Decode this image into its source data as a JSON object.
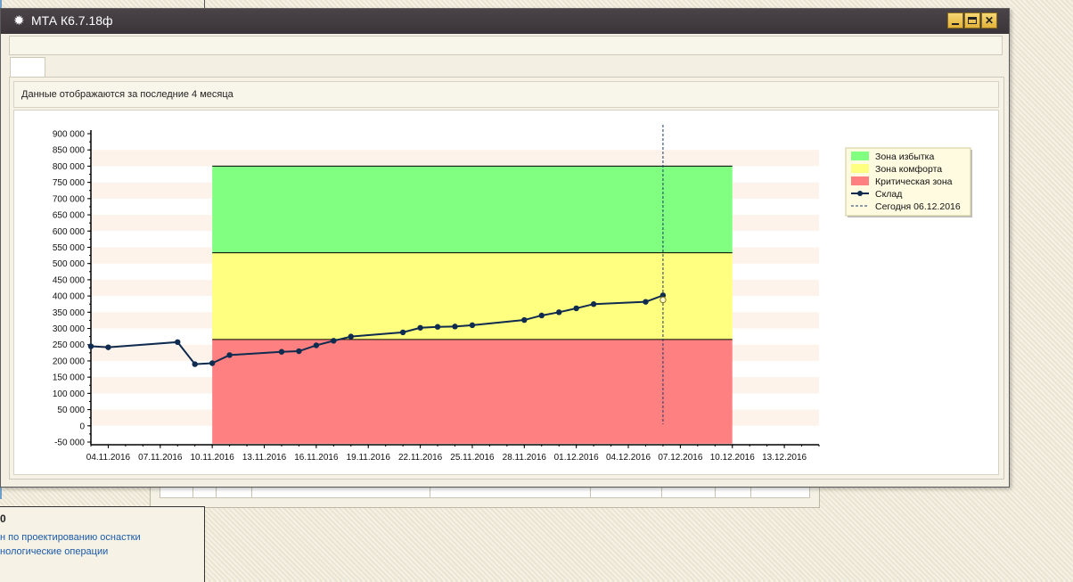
{
  "window": {
    "title": "МТА К6.7.18ф",
    "icon": "gear-icon"
  },
  "info": {
    "text": "Данные отображаются за последние 4 месяца"
  },
  "background": {
    "links": [
      "н по проектированию оснастки",
      "нологические операции"
    ]
  },
  "colors": {
    "excess": "#80ff80",
    "comfort": "#ffff80",
    "critical": "#ff8080",
    "series": "#0f2b4f",
    "band": "#fdf3ea"
  },
  "chart_data": {
    "type": "line",
    "y_ticks": [
      "900 000",
      "850 000",
      "800 000",
      "750 000",
      "700 000",
      "650 000",
      "600 000",
      "550 000",
      "500 000",
      "450 000",
      "400 000",
      "350 000",
      "300 000",
      "250 000",
      "200 000",
      "150 000",
      "100 000",
      "50 000",
      "0",
      "-50 000"
    ],
    "ylim": [
      -50000,
      900000
    ],
    "x_ticks": [
      "04.11.2016",
      "07.11.2016",
      "10.11.2016",
      "13.11.2016",
      "16.11.2016",
      "19.11.2016",
      "22.11.2016",
      "25.11.2016",
      "28.11.2016",
      "01.12.2016",
      "04.12.2016",
      "07.12.2016",
      "10.12.2016",
      "13.12.2016"
    ],
    "xlim": [
      "03.11.2016",
      "15.12.2016"
    ],
    "zones": [
      {
        "name": "Зона избытка",
        "from": 533000,
        "to": 800000,
        "color": "#80ff80"
      },
      {
        "name": "Зона комфорта",
        "from": 266000,
        "to": 533000,
        "color": "#ffff80"
      },
      {
        "name": "Критическая зона",
        "from": -55000,
        "to": 266000,
        "color": "#ff8080"
      }
    ],
    "zones_x": [
      "10.11.2016",
      "10.12.2016"
    ],
    "series": [
      {
        "name": "Склад",
        "x": [
          "03.11.2016",
          "04.11.2016",
          "08.11.2016",
          "09.11.2016",
          "10.11.2016",
          "11.11.2016",
          "14.11.2016",
          "15.11.2016",
          "16.11.2016",
          "17.11.2016",
          "18.11.2016",
          "21.11.2016",
          "22.11.2016",
          "23.11.2016",
          "24.11.2016",
          "25.11.2016",
          "28.11.2016",
          "29.11.2016",
          "30.11.2016",
          "01.12.2016",
          "02.12.2016",
          "05.12.2016",
          "06.12.2016"
        ],
        "values": [
          245000,
          242000,
          258000,
          190000,
          193000,
          218000,
          228000,
          230000,
          248000,
          262000,
          275000,
          288000,
          302000,
          305000,
          306000,
          310000,
          326000,
          340000,
          350000,
          362000,
          375000,
          382000,
          402000
        ]
      }
    ],
    "today_line": {
      "name": "Сегодня 06.12.2016",
      "x": "06.12.2016"
    },
    "legend": {
      "placement": "top-right",
      "entries": [
        "Зона избытка",
        "Зона комфорта",
        "Критическая зона",
        "Склад",
        "Сегодня 06.12.2016"
      ]
    }
  }
}
